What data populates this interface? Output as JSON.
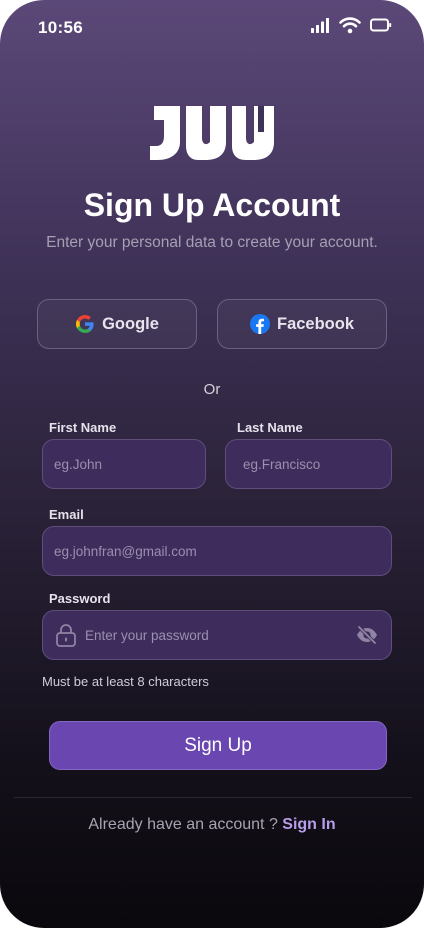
{
  "status_bar": {
    "time": "10:56"
  },
  "header": {
    "title": "Sign Up Account",
    "subtitle": "Enter your personal data to create your account."
  },
  "social": {
    "google_label": "Google",
    "facebook_label": "Facebook"
  },
  "separator_label": "Or",
  "form": {
    "first_name": {
      "label": "First Name",
      "placeholder": "eg.John",
      "value": ""
    },
    "last_name": {
      "label": "Last Name",
      "placeholder": "eg.Francisco",
      "value": ""
    },
    "email": {
      "label": "Email",
      "placeholder": "eg.johnfran@gmail.com",
      "value": ""
    },
    "password": {
      "label": "Password",
      "placeholder": "Enter your password",
      "value": ""
    },
    "password_hint": "Must be at least 8 characters"
  },
  "submit_label": "Sign Up",
  "footer": {
    "prompt": "Already have an account ? ",
    "link_label": "Sign In"
  },
  "colors": {
    "accent": "#6a47b0",
    "link": "#b89ee8",
    "input_bg": "#3e2c5c"
  },
  "icons": [
    "signal-icon",
    "wifi-icon",
    "battery-icon",
    "google-icon",
    "facebook-icon",
    "lock-icon",
    "eye-off-icon"
  ]
}
